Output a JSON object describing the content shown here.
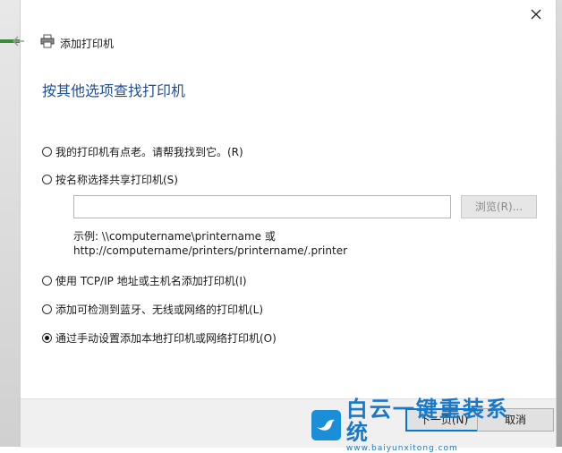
{
  "window": {
    "title": "添加打印机"
  },
  "heading": "按其他选项查找打印机",
  "options": [
    {
      "label": "我的打印机有点老。请帮我找到它。(R)",
      "selected": false
    },
    {
      "label": "按名称选择共享打印机(S)",
      "selected": false
    },
    {
      "label": "使用 TCP/IP 地址或主机名添加打印机(I)",
      "selected": false
    },
    {
      "label": "添加可检测到蓝牙、无线或网络的打印机(L)",
      "selected": false
    },
    {
      "label": "通过手动设置添加本地打印机或网络打印机(O)",
      "selected": true
    }
  ],
  "share_input": {
    "value": "",
    "placeholder": ""
  },
  "browse_label": "浏览(R)...",
  "example_line1": "示例: \\\\computername\\printername 或",
  "example_line2": "http://computername/printers/printername/.printer",
  "footer": {
    "next_label": "下一页(N)",
    "cancel_label": "取消"
  },
  "watermark": {
    "big": "白云一键重装系统",
    "small": "www.baiyunxitong.com"
  },
  "colors": {
    "heading": "#1f4e9a",
    "accent": "#0078d7"
  },
  "icons": {
    "close": "close-icon",
    "back": "back-arrow-icon",
    "printer": "printer-icon"
  }
}
